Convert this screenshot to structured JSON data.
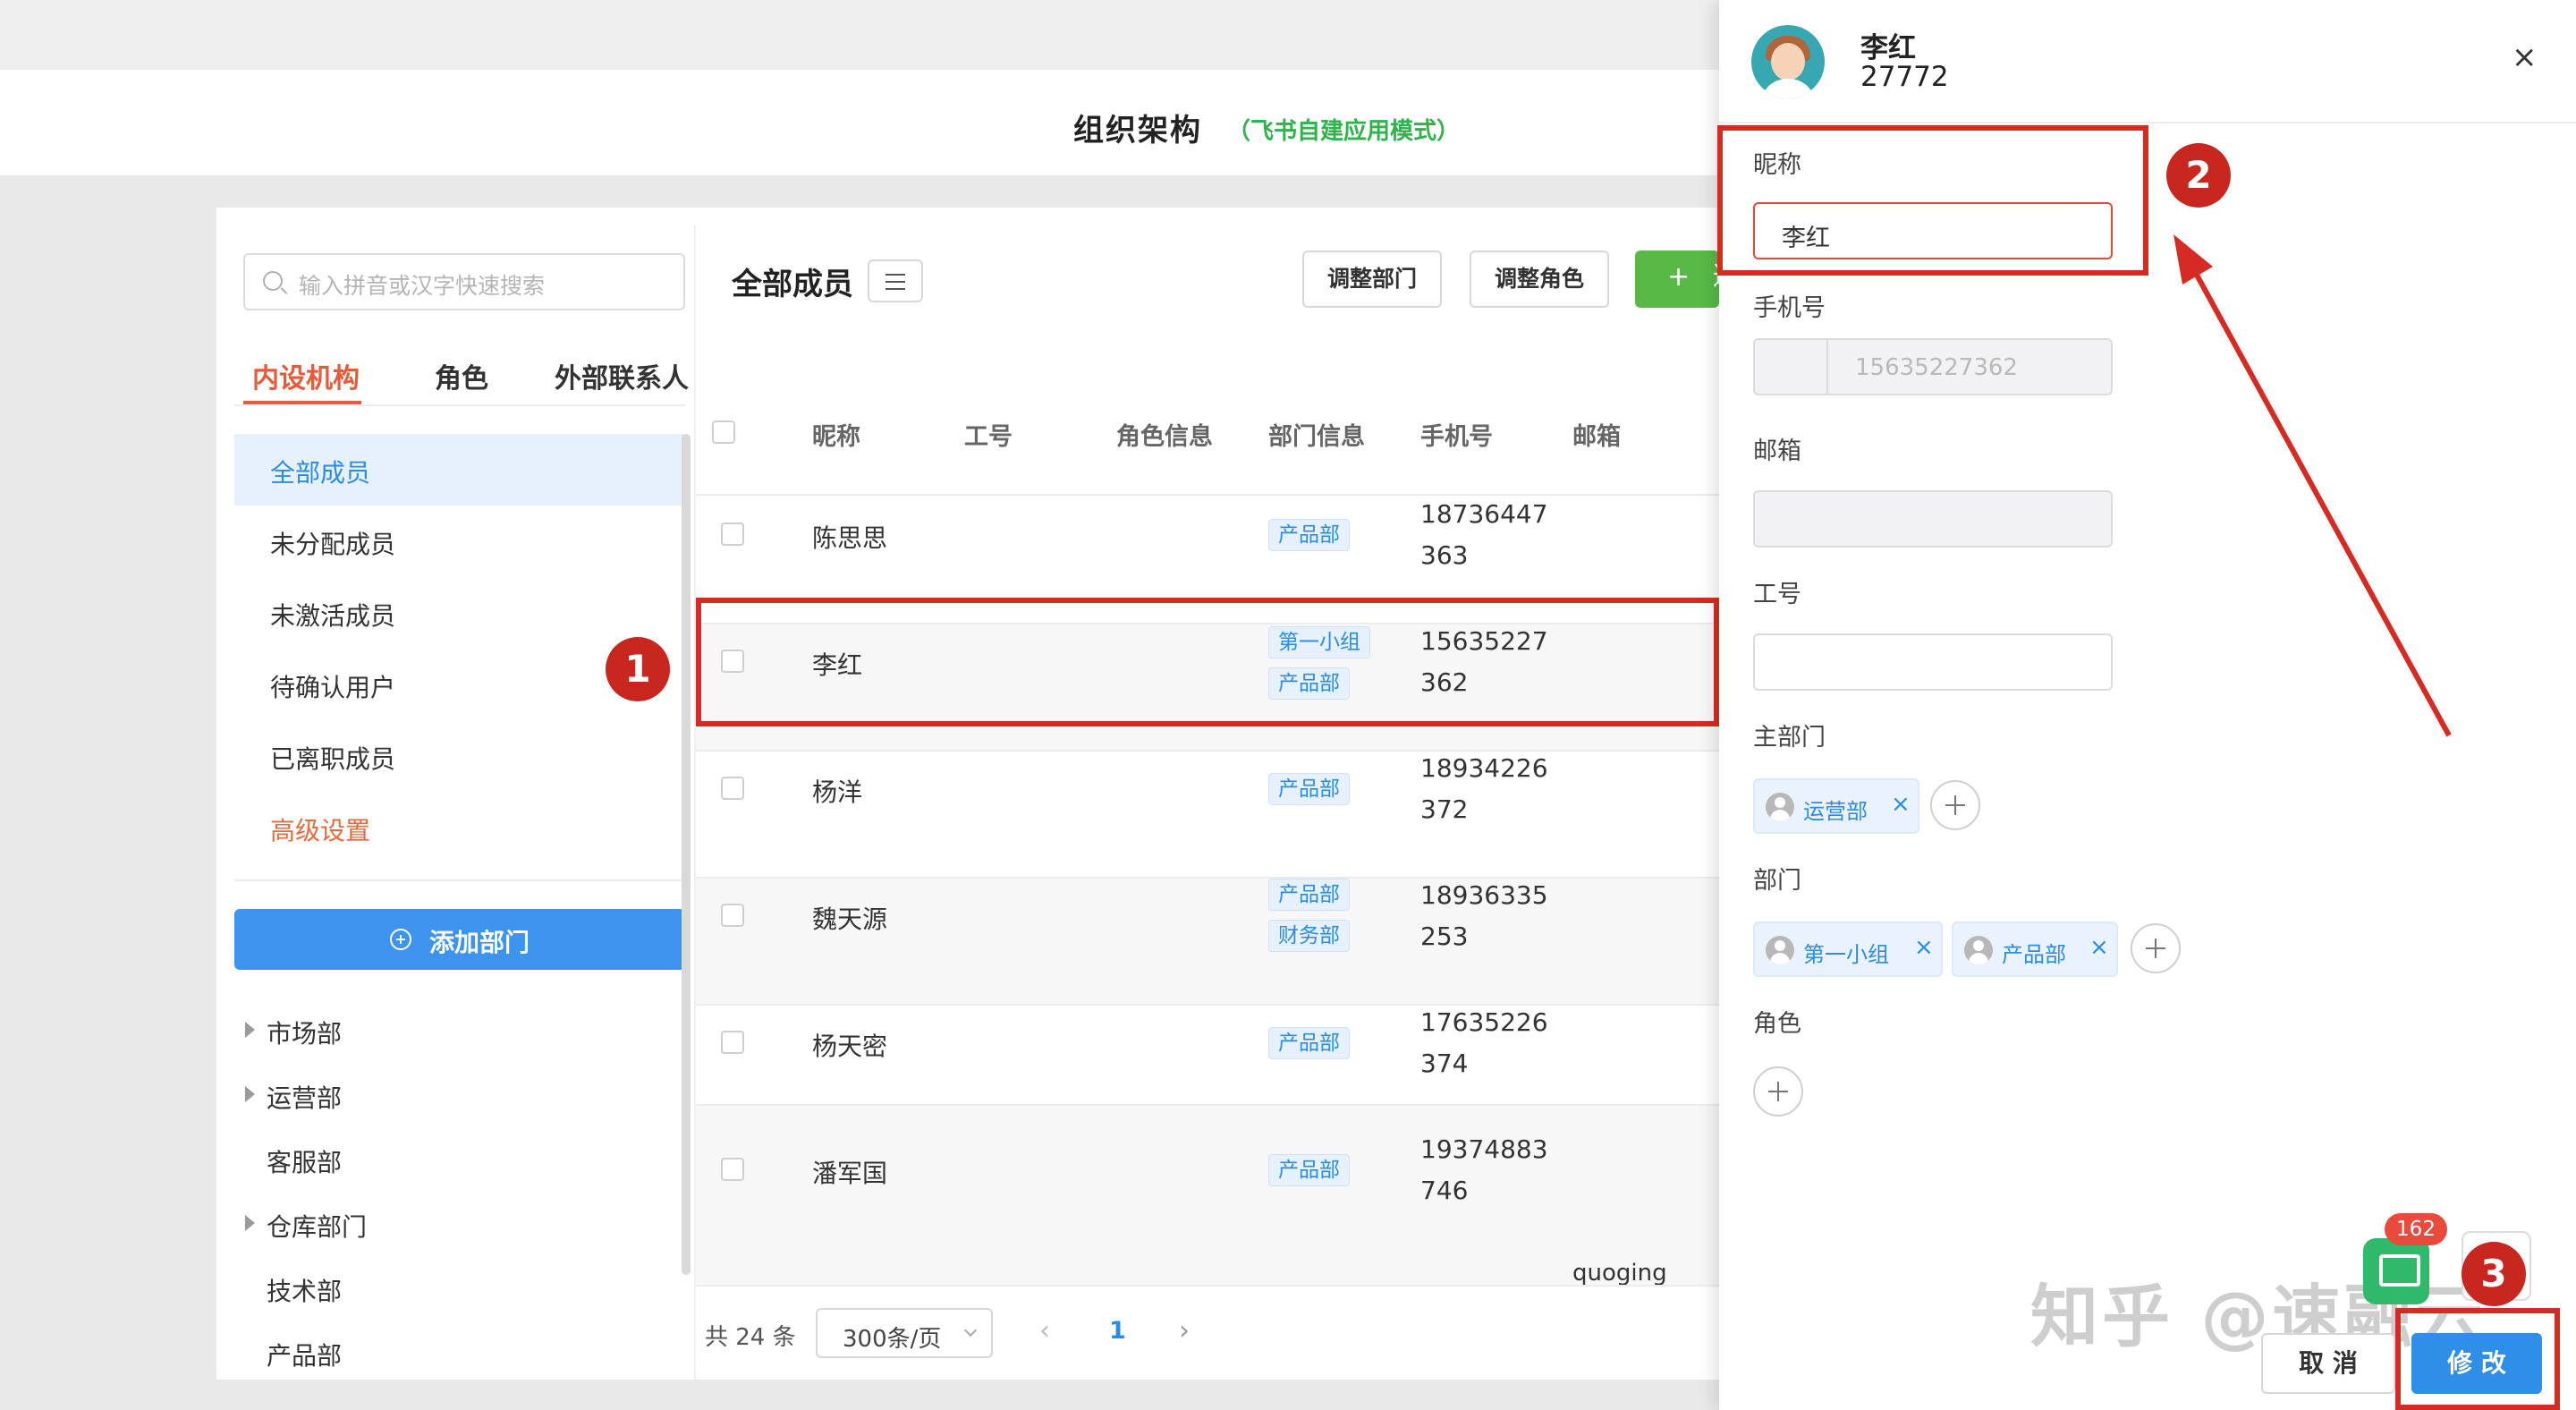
{
  "header": {
    "title": "组织架构",
    "subtitle": "（飞书自建应用模式）"
  },
  "left": {
    "search_placeholder": "输入拼音或汉字快速搜索",
    "tabs": [
      "内设机构",
      "角色",
      "外部联系人"
    ],
    "nav": [
      "全部成员",
      "未分配成员",
      "未激活成员",
      "待确认用户",
      "已离职成员",
      "高级设置"
    ],
    "add_dept_label": "添加部门",
    "departments": [
      "市场部",
      "运营部",
      "客服部",
      "仓库部门",
      "技术部",
      "产品部"
    ]
  },
  "main": {
    "title": "全部成员",
    "buttons": {
      "adjust_dept": "调整部门",
      "adjust_role": "调整角色",
      "add_symbol": "+",
      "add_label": "邀"
    },
    "columns": [
      "昵称",
      "工号",
      "角色信息",
      "部门信息",
      "手机号",
      "邮箱"
    ],
    "rows": [
      {
        "name": "陈思思",
        "tags": [
          "产品部"
        ],
        "phone": "18736447363"
      },
      {
        "name": "李红",
        "tags": [
          "第一小组",
          "产品部"
        ],
        "phone": "15635227362"
      },
      {
        "name": "杨洋",
        "tags": [
          "产品部"
        ],
        "phone": "18934226372"
      },
      {
        "name": "魏天源",
        "tags": [
          "产品部",
          "财务部"
        ],
        "phone": "18936335253"
      },
      {
        "name": "杨天密",
        "tags": [
          "产品部"
        ],
        "phone": "17635226374"
      },
      {
        "name": "潘军国",
        "tags": [
          "产品部"
        ],
        "phone": "19374883746"
      }
    ],
    "partial_row_text": "quoging",
    "pagination": {
      "total": "共 24 条",
      "page_size": "300条/页",
      "prev": "‹",
      "current": "1",
      "next": "›"
    }
  },
  "drawer": {
    "user_name": "李红",
    "user_id": "27772",
    "close": "×",
    "fields": {
      "nickname_label": "昵称",
      "nickname_value": "李红",
      "phone_label": "手机号",
      "phone_value": "15635227362",
      "email_label": "邮箱",
      "job_no_label": "工号",
      "main_dept_label": "主部门",
      "main_dept": [
        "运营部"
      ],
      "dept_label": "部门",
      "depts": [
        "第一小组",
        "产品部"
      ],
      "role_label": "角色"
    },
    "cancel_label": "取 消",
    "save_label": "修 改"
  },
  "annotations": {
    "badges": [
      "1",
      "2",
      "3"
    ],
    "color": "#d62b22"
  },
  "watermark": "知乎 @速融云",
  "app_badge_count": "162",
  "colors": {
    "primary": "#2f8ee8",
    "accent": "#e85b3a",
    "success": "#58b947",
    "tag_bg": "#e6f1fc"
  }
}
